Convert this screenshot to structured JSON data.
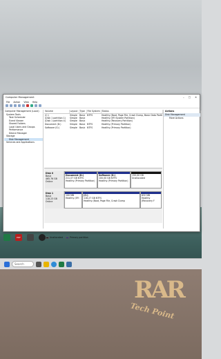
{
  "window": {
    "title": "Computer Management",
    "controls": [
      "–",
      "□",
      "✕"
    ]
  },
  "menu": [
    "File",
    "Action",
    "View",
    "Help"
  ],
  "tree": [
    "Computer Management (Local)",
    "System Tools",
    "Task Scheduler",
    "Event Viewer",
    "Shared Folders",
    "Local Users and Groups",
    "Performance",
    "Device Manager",
    "Storage",
    "Disk Management",
    "Services and Applications"
  ],
  "volume_table": {
    "headers": [
      "Volume",
      "Layout",
      "Type",
      "File System",
      "Status"
    ],
    "rows": [
      [
        "(C:)",
        "Simple",
        "Basic",
        "NTFS",
        "Healthy (Boot, Page File, Crash Dump, Basic Data Partition)"
      ],
      [
        "(Disk 1 partition 1)",
        "Simple",
        "Basic",
        "",
        "Healthy (EFI System Partition)"
      ],
      [
        "(Disk 1 partition 4)",
        "Simple",
        "Basic",
        "",
        "Healthy (Recovery Partition)"
      ],
      [
        "Document (D:)",
        "Simple",
        "Basic",
        "NTFS",
        "Healthy (Primary Partition)"
      ],
      [
        "Software (G:)",
        "Simple",
        "Basic",
        "NTFS",
        "Healthy (Primary Partition)"
      ]
    ]
  },
  "disks": [
    {
      "label": "Disk 0",
      "type": "Basic",
      "size": "465.76 GB",
      "state": "Online",
      "partitions": [
        {
          "name": "Document (D:)",
          "size": "211.07 GB NTFS",
          "status": "Healthy (Primary Partition)"
        },
        {
          "name": "Software (G:)",
          "size": "100.00 GB NTFS",
          "status": "Healthy (Primary Partition)"
        },
        {
          "name": "",
          "size": "150.00 GB",
          "status": "Unallocated"
        }
      ]
    },
    {
      "label": "Disk 1",
      "type": "Basic",
      "size": "118.23 GB",
      "state": "Online",
      "partitions": [
        {
          "name": "",
          "size": "100 MB",
          "status": "Healthy (EFI"
        },
        {
          "name": "(C:)",
          "size": "116.27 GB NTFS",
          "status": "Healthy (Boot, Page File, Crash Dump"
        },
        {
          "name": "",
          "size": "832 MB",
          "status": "Healthy (Recovery F"
        }
      ]
    }
  ],
  "legend": [
    "Unallocated",
    "Primary partition"
  ],
  "actions": {
    "header": "Actions",
    "section": "Disk Management",
    "more": "More Actions"
  },
  "taskbar": {
    "search": "Search"
  },
  "desktop_icons": [
    "",
    "PDF",
    "",
    ""
  ],
  "logo": {
    "mark": "RAR",
    "text": "Tech Point"
  },
  "colors": {
    "primary_partition": "#1e2f8c",
    "unallocated": "#111111",
    "accent": "#d9b98a"
  }
}
